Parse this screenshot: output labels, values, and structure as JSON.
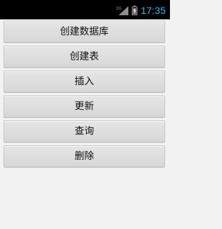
{
  "status_bar": {
    "network": "3G",
    "time": "17:35",
    "signal_icon": "signal-icon",
    "battery_icon": "battery-icon"
  },
  "buttons": [
    {
      "label": "创建数据库"
    },
    {
      "label": "创建表"
    },
    {
      "label": "插入"
    },
    {
      "label": "更新"
    },
    {
      "label": "查询"
    },
    {
      "label": "删除"
    }
  ],
  "colors": {
    "status_background": "#000000",
    "status_accent": "#33b5e5",
    "screen_background": "#f2f2f2",
    "button_background": "#dddddd",
    "button_text": "#111111"
  }
}
